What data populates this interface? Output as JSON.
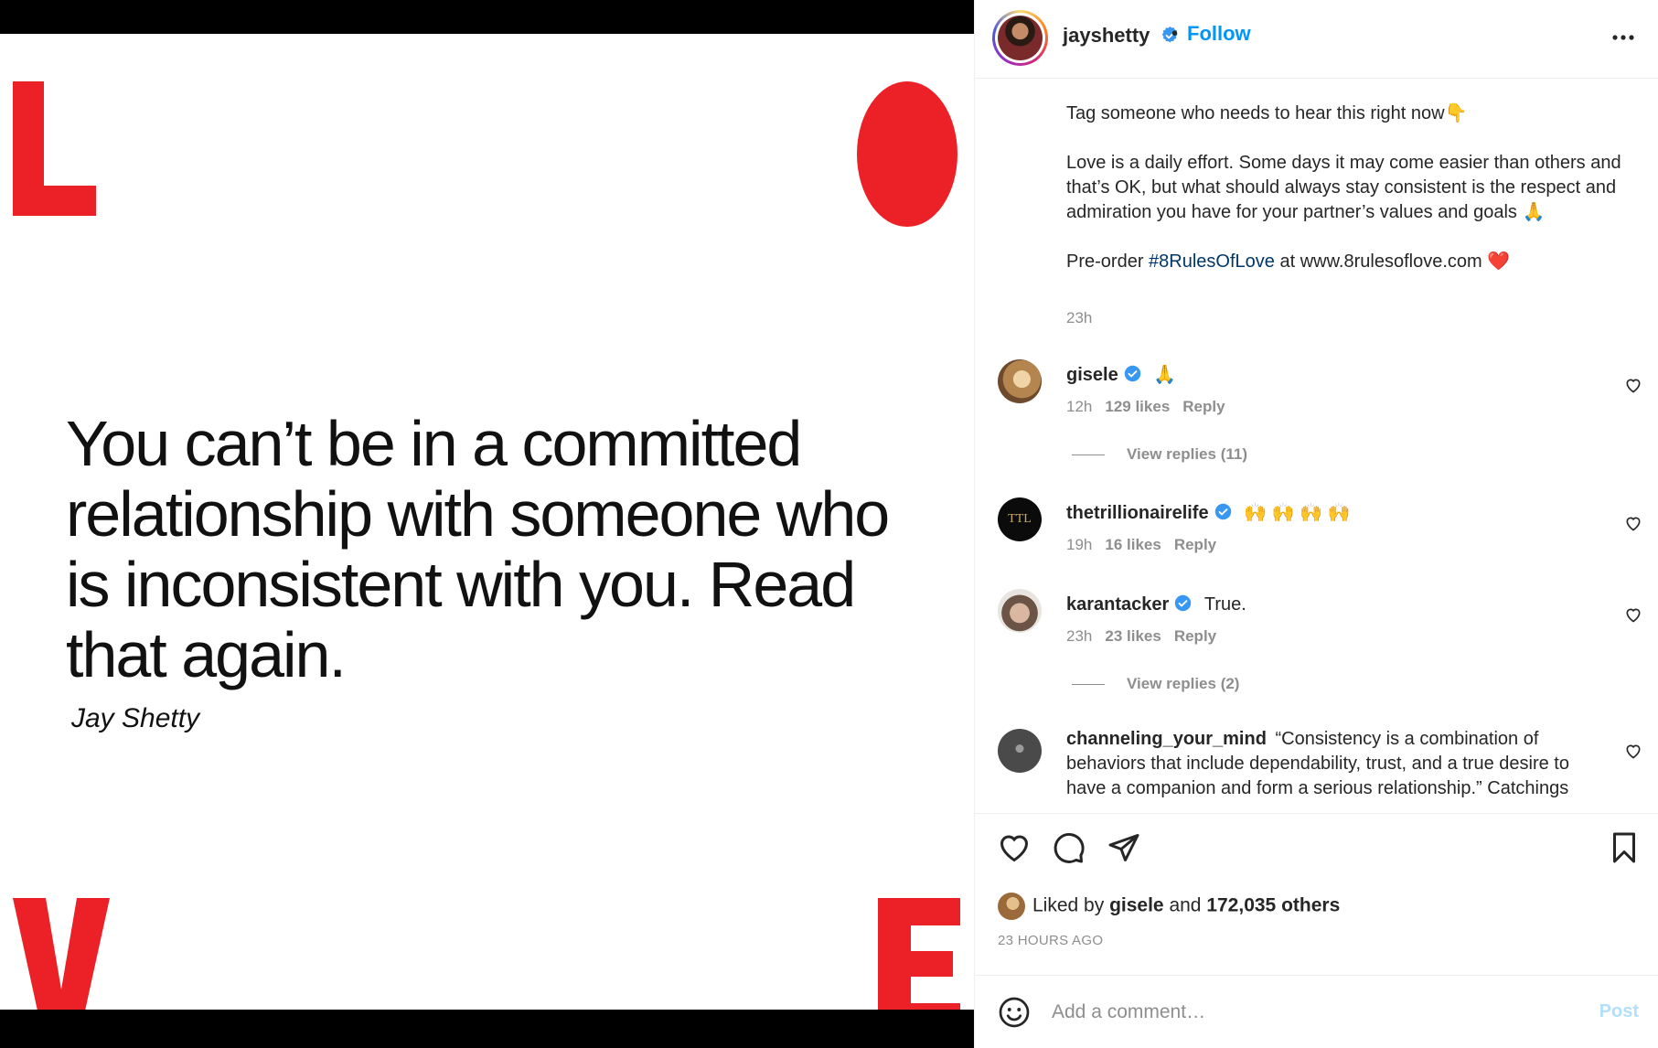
{
  "post_image": {
    "letters": {
      "l": "L",
      "v": "V",
      "e": "E"
    },
    "quote": "You can’t be in a committed relationship with someone who is inconsistent with you. Read that again.",
    "author": "Jay Shetty",
    "accent_color": "#ec2027"
  },
  "header": {
    "username": "jayshetty",
    "dot": "•",
    "follow_label": "Follow",
    "more_icon": "more-horizontal-icon"
  },
  "caption": {
    "line1": "Tag someone who needs to hear this right now👇",
    "paragraph2": "Love is a daily effort. Some days it may come easier than others and that’s OK, but what should always stay consistent is the respect and admiration you have for your partner’s values and goals 🙏",
    "preorder_prefix": "Pre-order ",
    "hashtag": "#8RulesOfLove",
    "preorder_suffix": " at www.8rulesoflove.com ❤️",
    "time": "23h"
  },
  "comments": [
    {
      "user": "gisele",
      "verified": true,
      "text": "🙏",
      "time": "12h",
      "likes": "129 likes",
      "reply": "Reply",
      "view_replies": "View replies (11)"
    },
    {
      "user": "thetrillionairelife",
      "verified": true,
      "text": "🙌 🙌 🙌 🙌",
      "time": "19h",
      "likes": "16 likes",
      "reply": "Reply",
      "avatar_text": "TTL"
    },
    {
      "user": "karantacker",
      "verified": true,
      "text": "True.",
      "time": "23h",
      "likes": "23 likes",
      "reply": "Reply",
      "view_replies": "View replies (2)"
    },
    {
      "user": "channeling_your_mind",
      "verified": false,
      "text": "“Consistency is a combination of behaviors that include dependability, trust, and a true desire to have a companion and form a serious relationship.” Catchings"
    }
  ],
  "likes": {
    "prefix": "Liked by ",
    "user": "gisele",
    "middle": " and ",
    "others": "172,035 others"
  },
  "post_date": "23 HOURS AGO",
  "comment_box": {
    "placeholder": "Add a comment…",
    "post_label": "Post"
  },
  "colors": {
    "link_blue": "#0095f6",
    "hashtag_blue": "#00376b",
    "muted": "#8e8e8e",
    "post_disabled": "#b2dffc"
  }
}
